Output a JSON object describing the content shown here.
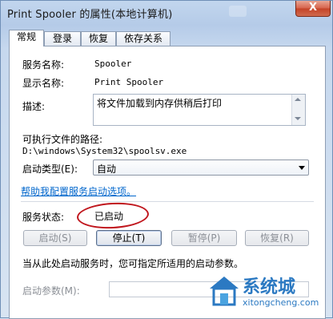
{
  "window": {
    "title": "Print Spooler 的属性(本地计算机)",
    "close_glyph": "X"
  },
  "tabs": [
    {
      "label": "常规",
      "active": true
    },
    {
      "label": "登录",
      "active": false
    },
    {
      "label": "恢复",
      "active": false
    },
    {
      "label": "依存关系",
      "active": false
    }
  ],
  "general": {
    "service_name_label": "服务名称:",
    "service_name_value": "Spooler",
    "display_name_label": "显示名称:",
    "display_name_value": "Print Spooler",
    "description_label": "描述:",
    "description_value": "将文件加载到内存供稍后打印",
    "exe_path_label": "可执行文件的路径:",
    "exe_path_value": "D:\\windows\\System32\\spoolsv.exe",
    "startup_type_label": "启动类型(E):",
    "startup_type_value": "自动",
    "help_link": "帮助我配置服务启动选项。",
    "status_label": "服务状态:",
    "status_value": "已启动",
    "buttons": {
      "start": "启动(S)",
      "stop": "停止(T)",
      "pause": "暂停(P)",
      "resume": "恢复(R)"
    },
    "hint": "当从此处启动服务时，您可指定所适用的启动参数。",
    "start_params_label": "启动参数(M):",
    "start_params_value": ""
  },
  "watermark": {
    "cn": "系统城",
    "en": "xitongcheng.com"
  },
  "colors": {
    "link": "#0066cc",
    "highlight_circle": "#c0161d",
    "watermark": "#2b79c2"
  }
}
